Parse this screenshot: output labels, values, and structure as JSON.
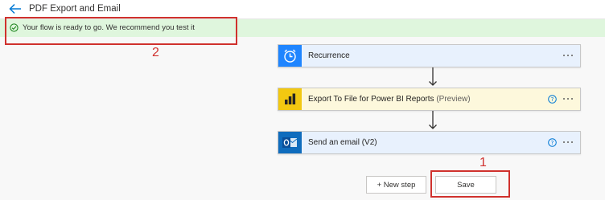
{
  "header": {
    "title": "PDF Export and Email",
    "back_icon": "back-arrow-icon"
  },
  "banner": {
    "message": "Your flow is ready to go. We recommend you test it",
    "icon": "checkmark-circle-icon",
    "color": "#dff6dd"
  },
  "flow": {
    "steps": [
      {
        "label": "Recurrence",
        "badge": "",
        "icon": "alarm-clock-icon",
        "color": "#1f85ff",
        "tint": "#e8f1fd",
        "has_help": false
      },
      {
        "label": "Export To File for Power BI Reports",
        "badge": "(Preview)",
        "icon": "power-bi-icon",
        "color": "#f2c811",
        "tint": "#fdf8dc",
        "has_help": true
      },
      {
        "label": "Send an email (V2)",
        "badge": "",
        "icon": "outlook-icon",
        "color": "#0f6cbd",
        "tint": "#e8f1fd",
        "has_help": true
      }
    ],
    "new_step_label": "+ New step",
    "save_label": "Save"
  },
  "annotations": {
    "save_marker": "1",
    "banner_marker": "2",
    "color": "#d0312d"
  }
}
